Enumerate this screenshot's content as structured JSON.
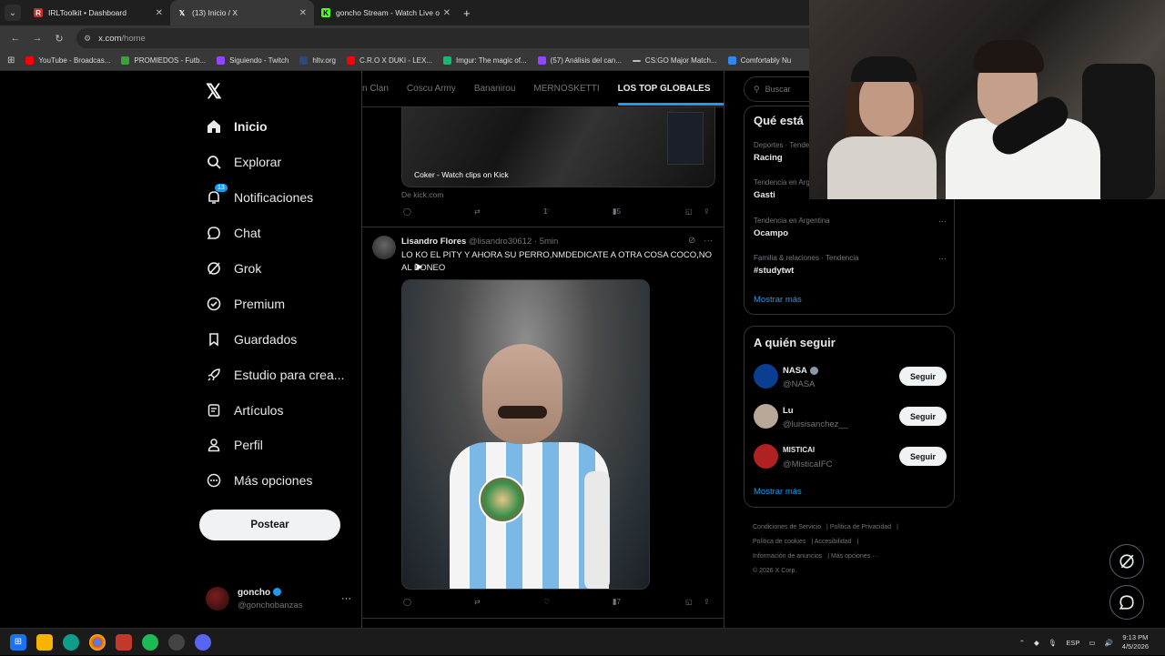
{
  "browser": {
    "tabs": [
      {
        "title": "IRLToolkit • Dashboard",
        "favicon": "irltoolkit-icon",
        "color": "#c4302b"
      },
      {
        "title": "(13) Inicio / X",
        "favicon": "x-icon",
        "color": "#ffffff",
        "active": true
      },
      {
        "title": "goncho Stream - Watch Live on",
        "favicon": "kick-icon",
        "color": "#53fc18"
      }
    ],
    "url_host": "x.com",
    "url_path": "/home",
    "bookmarks": [
      {
        "label": "YouTube - Broadcas...",
        "color": "#ff0000"
      },
      {
        "label": "PROMIEDOS - Futb...",
        "color": "#3aa335"
      },
      {
        "label": "Siguiendo - Twitch",
        "color": "#9146ff"
      },
      {
        "label": "hltv.org",
        "color": "#2b4a7a"
      },
      {
        "label": "C.R.O X DUKI - LEX...",
        "color": "#ff0000"
      },
      {
        "label": "Imgur: The magic of...",
        "color": "#1bb76e"
      },
      {
        "label": "(57) Análisis del can...",
        "color": "#9146ff"
      },
      {
        "label": "CS:GO Major Match...",
        "color": "#bbbbbb"
      },
      {
        "label": "Comfortably Nu",
        "color": "#2d89ef"
      }
    ]
  },
  "sidebar": {
    "logo": "𝕏",
    "items": [
      {
        "label": "Inicio",
        "icon": "home-icon"
      },
      {
        "label": "Explorar",
        "icon": "search-icon"
      },
      {
        "label": "Notificaciones",
        "icon": "bell-icon",
        "badge": "13"
      },
      {
        "label": "Chat",
        "icon": "chat-icon"
      },
      {
        "label": "Grok",
        "icon": "grok-icon"
      },
      {
        "label": "Premium",
        "icon": "premium-icon"
      },
      {
        "label": "Guardados",
        "icon": "bookmark-icon"
      },
      {
        "label": "Estudio para crea...",
        "icon": "rocket-icon"
      },
      {
        "label": "Artículos",
        "icon": "articles-icon"
      },
      {
        "label": "Perfil",
        "icon": "profile-icon"
      },
      {
        "label": "Más opciones",
        "icon": "more-icon"
      }
    ],
    "post_button": "Postear",
    "account": {
      "name": "goncho",
      "handle": "@gonchobanzas"
    }
  },
  "feed": {
    "tabs": [
      "n Clan",
      "Coscu Army",
      "Bananirou",
      "MERNOSKETTI",
      "LOS TOP GLOBALES"
    ],
    "card_caption": "Coker - Watch clips on Kick",
    "card_source": "De kick.com",
    "prev_actions": {
      "likes": "1",
      "views": "35"
    },
    "tweet": {
      "name": "Lisandro Flores",
      "handle": "@lisandro30612",
      "time": "· 5min",
      "text": "LO KO EL PITY Y AHORA SU PERRO,NMDEDICATE A OTRA COSA COCO,NO AL BONEO",
      "views": "27"
    }
  },
  "right": {
    "search_placeholder": "Buscar",
    "trends_title": "Qué está",
    "trends": [
      {
        "context": "Deportes · Tendencia",
        "title": "Racing"
      },
      {
        "context": "Tendencia en Argentina",
        "title": "Gasti"
      },
      {
        "context": "Tendencia en Argentina",
        "title": "Ocampo"
      },
      {
        "context": "Familia & relaciones · Tendencia",
        "title": "#studytwt"
      }
    ],
    "show_more": "Mostrar más",
    "follow_title": "A quién seguir",
    "follow": [
      {
        "name": "NASA",
        "handle": "@NASA",
        "button": "Seguir",
        "color": "#0b3d91"
      },
      {
        "name": "Lu",
        "handle": "@luisisanchez__",
        "button": "Seguir",
        "color": "#b8a898"
      },
      {
        "name": "MISTICAI",
        "handle": "@MisticaIFC",
        "button": "Seguir",
        "color": "#b02222"
      }
    ],
    "follow_more": "Mostrar más",
    "footer": [
      "Condiciones de Servicio",
      "Política de Privacidad",
      "Política de cookies",
      "Accesibilidad",
      "Información de anuncios",
      "Más opciones ···",
      "© 2026 X Corp."
    ]
  },
  "taskbar": {
    "lang": "ESP",
    "time": "9:13 PM",
    "date": "4/5/2026"
  }
}
